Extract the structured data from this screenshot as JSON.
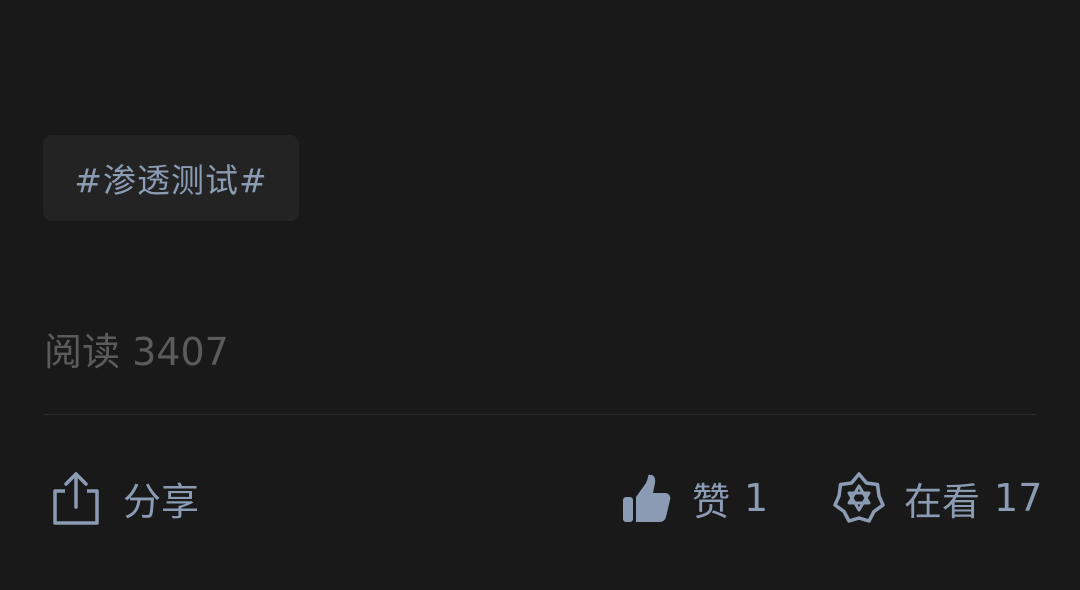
{
  "tag": {
    "text": "#渗透测试#"
  },
  "read": {
    "label": "阅读",
    "count": "3407"
  },
  "actions": {
    "share": {
      "label": "分享",
      "icon": "share-icon"
    },
    "like": {
      "label": "赞",
      "count": "1",
      "icon": "thumbs-up-icon"
    },
    "watching": {
      "label": "在看",
      "count": "17",
      "icon": "star-badge-icon"
    }
  },
  "colors": {
    "background": "#191919",
    "tag_background": "#232323",
    "accent": "#8a9bb3",
    "muted_text": "#5b5b5b",
    "divider": "#2a2a2a"
  }
}
